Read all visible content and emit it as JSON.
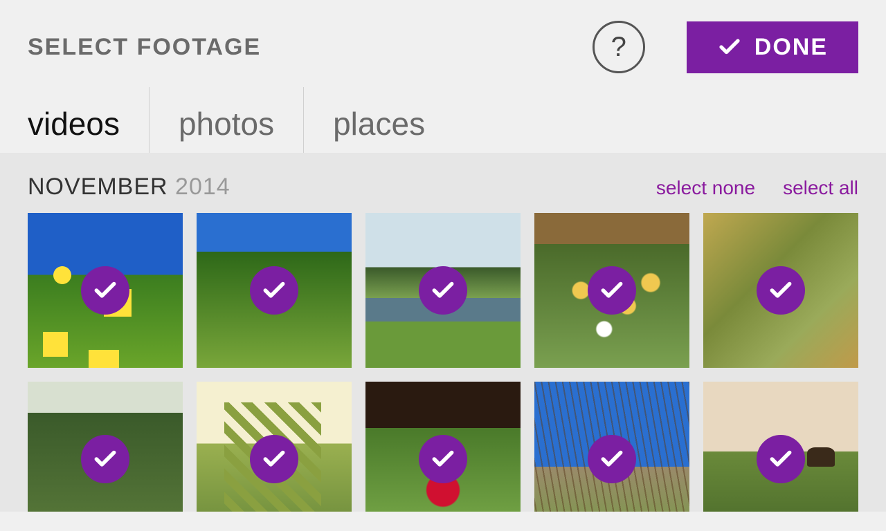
{
  "header": {
    "title": "SELECT FOOTAGE",
    "help_icon": "help-icon",
    "done_label": "DONE"
  },
  "tabs": [
    {
      "label": "videos",
      "active": true
    },
    {
      "label": "photos",
      "active": false
    },
    {
      "label": "places",
      "active": false
    }
  ],
  "section": {
    "month": "NOVEMBER",
    "year": "2014",
    "select_none_label": "select none",
    "select_all_label": "select all"
  },
  "colors": {
    "accent": "#7b1fa2"
  },
  "thumbnails": [
    {
      "selected": true,
      "desc": "yellow-flowers-blue-sky"
    },
    {
      "selected": true,
      "desc": "green-hedge-blue-sky"
    },
    {
      "selected": true,
      "desc": "pond-trees-lawn"
    },
    {
      "selected": true,
      "desc": "orange-garden-flowers"
    },
    {
      "selected": true,
      "desc": "autumn-foliage"
    },
    {
      "selected": true,
      "desc": "green-shrubs"
    },
    {
      "selected": true,
      "desc": "leafy-branch-closeup"
    },
    {
      "selected": true,
      "desc": "red-flower-soil"
    },
    {
      "selected": true,
      "desc": "bare-tree-blue-sky"
    },
    {
      "selected": true,
      "desc": "cows-field-sunset"
    }
  ]
}
